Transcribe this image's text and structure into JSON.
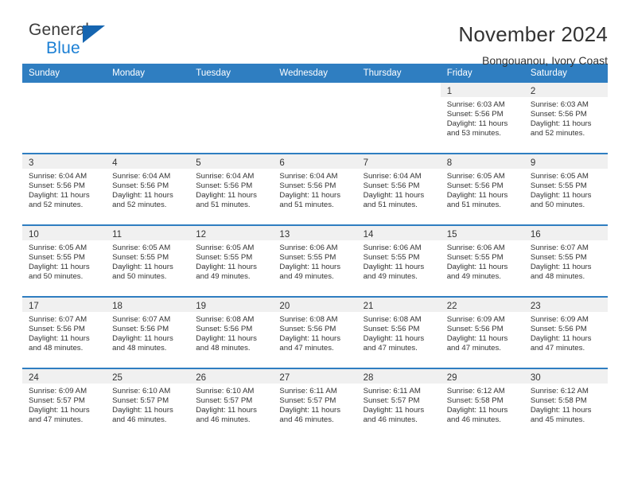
{
  "brand": {
    "name_part1": "General",
    "name_part2": "Blue",
    "triangle_color": "#1565b0",
    "blue_color": "#1b7fd4"
  },
  "header": {
    "month_title": "November 2024",
    "location": "Bongouanou, Ivory Coast"
  },
  "theme": {
    "header_blue": "#2f7ec1",
    "daynum_band": "#f0f0f0",
    "text": "#333333"
  },
  "calendar": {
    "weekday_headers": [
      "Sunday",
      "Monday",
      "Tuesday",
      "Wednesday",
      "Thursday",
      "Friday",
      "Saturday"
    ],
    "weeks": [
      [
        {
          "day": "",
          "lines": []
        },
        {
          "day": "",
          "lines": []
        },
        {
          "day": "",
          "lines": []
        },
        {
          "day": "",
          "lines": []
        },
        {
          "day": "",
          "lines": []
        },
        {
          "day": "1",
          "lines": [
            "Sunrise: 6:03 AM",
            "Sunset: 5:56 PM",
            "Daylight: 11 hours",
            "and 53 minutes."
          ]
        },
        {
          "day": "2",
          "lines": [
            "Sunrise: 6:03 AM",
            "Sunset: 5:56 PM",
            "Daylight: 11 hours",
            "and 52 minutes."
          ]
        }
      ],
      [
        {
          "day": "3",
          "lines": [
            "Sunrise: 6:04 AM",
            "Sunset: 5:56 PM",
            "Daylight: 11 hours",
            "and 52 minutes."
          ]
        },
        {
          "day": "4",
          "lines": [
            "Sunrise: 6:04 AM",
            "Sunset: 5:56 PM",
            "Daylight: 11 hours",
            "and 52 minutes."
          ]
        },
        {
          "day": "5",
          "lines": [
            "Sunrise: 6:04 AM",
            "Sunset: 5:56 PM",
            "Daylight: 11 hours",
            "and 51 minutes."
          ]
        },
        {
          "day": "6",
          "lines": [
            "Sunrise: 6:04 AM",
            "Sunset: 5:56 PM",
            "Daylight: 11 hours",
            "and 51 minutes."
          ]
        },
        {
          "day": "7",
          "lines": [
            "Sunrise: 6:04 AM",
            "Sunset: 5:56 PM",
            "Daylight: 11 hours",
            "and 51 minutes."
          ]
        },
        {
          "day": "8",
          "lines": [
            "Sunrise: 6:05 AM",
            "Sunset: 5:56 PM",
            "Daylight: 11 hours",
            "and 51 minutes."
          ]
        },
        {
          "day": "9",
          "lines": [
            "Sunrise: 6:05 AM",
            "Sunset: 5:55 PM",
            "Daylight: 11 hours",
            "and 50 minutes."
          ]
        }
      ],
      [
        {
          "day": "10",
          "lines": [
            "Sunrise: 6:05 AM",
            "Sunset: 5:55 PM",
            "Daylight: 11 hours",
            "and 50 minutes."
          ]
        },
        {
          "day": "11",
          "lines": [
            "Sunrise: 6:05 AM",
            "Sunset: 5:55 PM",
            "Daylight: 11 hours",
            "and 50 minutes."
          ]
        },
        {
          "day": "12",
          "lines": [
            "Sunrise: 6:05 AM",
            "Sunset: 5:55 PM",
            "Daylight: 11 hours",
            "and 49 minutes."
          ]
        },
        {
          "day": "13",
          "lines": [
            "Sunrise: 6:06 AM",
            "Sunset: 5:55 PM",
            "Daylight: 11 hours",
            "and 49 minutes."
          ]
        },
        {
          "day": "14",
          "lines": [
            "Sunrise: 6:06 AM",
            "Sunset: 5:55 PM",
            "Daylight: 11 hours",
            "and 49 minutes."
          ]
        },
        {
          "day": "15",
          "lines": [
            "Sunrise: 6:06 AM",
            "Sunset: 5:55 PM",
            "Daylight: 11 hours",
            "and 49 minutes."
          ]
        },
        {
          "day": "16",
          "lines": [
            "Sunrise: 6:07 AM",
            "Sunset: 5:55 PM",
            "Daylight: 11 hours",
            "and 48 minutes."
          ]
        }
      ],
      [
        {
          "day": "17",
          "lines": [
            "Sunrise: 6:07 AM",
            "Sunset: 5:56 PM",
            "Daylight: 11 hours",
            "and 48 minutes."
          ]
        },
        {
          "day": "18",
          "lines": [
            "Sunrise: 6:07 AM",
            "Sunset: 5:56 PM",
            "Daylight: 11 hours",
            "and 48 minutes."
          ]
        },
        {
          "day": "19",
          "lines": [
            "Sunrise: 6:08 AM",
            "Sunset: 5:56 PM",
            "Daylight: 11 hours",
            "and 48 minutes."
          ]
        },
        {
          "day": "20",
          "lines": [
            "Sunrise: 6:08 AM",
            "Sunset: 5:56 PM",
            "Daylight: 11 hours",
            "and 47 minutes."
          ]
        },
        {
          "day": "21",
          "lines": [
            "Sunrise: 6:08 AM",
            "Sunset: 5:56 PM",
            "Daylight: 11 hours",
            "and 47 minutes."
          ]
        },
        {
          "day": "22",
          "lines": [
            "Sunrise: 6:09 AM",
            "Sunset: 5:56 PM",
            "Daylight: 11 hours",
            "and 47 minutes."
          ]
        },
        {
          "day": "23",
          "lines": [
            "Sunrise: 6:09 AM",
            "Sunset: 5:56 PM",
            "Daylight: 11 hours",
            "and 47 minutes."
          ]
        }
      ],
      [
        {
          "day": "24",
          "lines": [
            "Sunrise: 6:09 AM",
            "Sunset: 5:57 PM",
            "Daylight: 11 hours",
            "and 47 minutes."
          ]
        },
        {
          "day": "25",
          "lines": [
            "Sunrise: 6:10 AM",
            "Sunset: 5:57 PM",
            "Daylight: 11 hours",
            "and 46 minutes."
          ]
        },
        {
          "day": "26",
          "lines": [
            "Sunrise: 6:10 AM",
            "Sunset: 5:57 PM",
            "Daylight: 11 hours",
            "and 46 minutes."
          ]
        },
        {
          "day": "27",
          "lines": [
            "Sunrise: 6:11 AM",
            "Sunset: 5:57 PM",
            "Daylight: 11 hours",
            "and 46 minutes."
          ]
        },
        {
          "day": "28",
          "lines": [
            "Sunrise: 6:11 AM",
            "Sunset: 5:57 PM",
            "Daylight: 11 hours",
            "and 46 minutes."
          ]
        },
        {
          "day": "29",
          "lines": [
            "Sunrise: 6:12 AM",
            "Sunset: 5:58 PM",
            "Daylight: 11 hours",
            "and 46 minutes."
          ]
        },
        {
          "day": "30",
          "lines": [
            "Sunrise: 6:12 AM",
            "Sunset: 5:58 PM",
            "Daylight: 11 hours",
            "and 45 minutes."
          ]
        }
      ]
    ]
  }
}
